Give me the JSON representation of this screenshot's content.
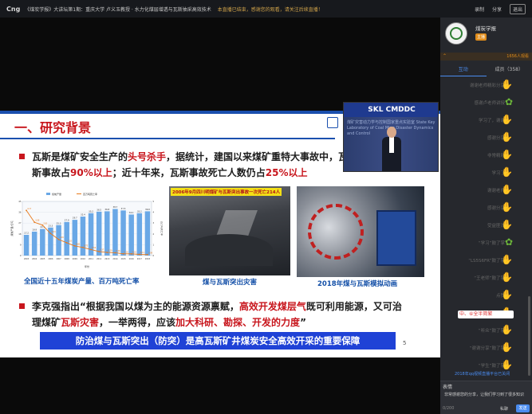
{
  "topbar": {
    "logo": "Cng",
    "title": "《煤炭学报》大讲坛第1期：重庆大学 卢义玉教授  · 水力化煤层增透与瓦斯抽采高效技术",
    "notice": "本直播已结束，感谢您的观看，请关注后续直播！",
    "btn_record": "录制",
    "btn_share": "分享",
    "btn_exit": "退出"
  },
  "slide": {
    "heading": "一、研究背景",
    "b1_a": "瓦斯是煤矿安全生产的",
    "b1_red1": "头号杀手",
    "b1_b": "，据统计，建国以来煤矿重特大事故中，瓦斯事故占",
    "b1_red2": "90%以上",
    "b1_c": "；近十年来，瓦斯事故死亡人数仍占",
    "b1_red3": "25%以上",
    "cap_chart": "全国近十五年煤炭产量、百万吨死亡率",
    "tunnel_tag": "2006年9月四川明煤矿与瓦斯突出事故一次死亡214人",
    "cap_tunnel": "煤与瓦斯突出灾害",
    "cap_sim": "2018年煤与瓦斯模拟动画",
    "b3_a": "李克强指出“根据我国以煤为主的能源资源禀赋，",
    "b3_red1": "高效开发煤层气",
    "b3_b": "既可利用能源，又可治理煤矿",
    "b3_red2": "瓦斯灾害",
    "b3_c": "，一举两得，应该",
    "b3_red3": "加大科研、勘探、开发的力度",
    "b3_d": "”",
    "banner": "防治煤与瓦斯突出（防突）是高瓦斯矿井煤炭安全高效开采的重要保障",
    "page": "5"
  },
  "camera": {
    "sign": "SKL CMDDC",
    "wall_text": "煤矿灾害动力学与控制国家重点实验室 State Key Laboratory of Coal Mine Disaster Dynamics and Control"
  },
  "chart_data": {
    "type": "bar",
    "title": "",
    "categories": [
      "2003",
      "2004",
      "2005",
      "2006",
      "2007",
      "2008",
      "2009",
      "2010",
      "2011",
      "2012",
      "2013",
      "2014",
      "2015",
      "2016",
      "2017",
      "2018"
    ],
    "series": [
      {
        "name": "煤炭产量",
        "values": [
          17.2,
          19.9,
          22.1,
          23.3,
          25.3,
          27.9,
          29.7,
          32.4,
          35.2,
          36.5,
          36.8,
          38.7,
          37.5,
          34.1,
          35.2,
          36.8
        ]
      },
      {
        "name": "百万吨死亡率",
        "values": [
          4.17,
          3.08,
          2.81,
          2.04,
          1.49,
          1.18,
          0.89,
          0.75,
          0.56,
          0.37,
          0.29,
          0.26,
          0.16,
          0.16,
          0.11,
          0.09
        ]
      }
    ],
    "legend": "top",
    "colors": [
      "#6aa8e6",
      "#e8791a"
    ],
    "xlabel": "年份",
    "ylabel": "煤炭产量/亿吨",
    "y2label": "百万吨死亡率",
    "ylim": [
      0,
      45
    ],
    "y2lim": [
      0,
      5
    ]
  },
  "sidebar": {
    "channel_name": "煤炭学报",
    "badge": "主播",
    "viewers": "1656人观看",
    "tabs": [
      "互动",
      "成员（358）"
    ],
    "messages": [
      {
        "text": "谢谢老师精彩分享",
        "icon": "hand"
      },
      {
        "text": "感谢卢老师讲授",
        "icon": "flower"
      },
      {
        "text": "学习了，谢谢",
        "icon": "hand"
      },
      {
        "text": "感谢分享",
        "icon": "hand"
      },
      {
        "text": "非常精彩",
        "icon": "hand"
      },
      {
        "text": "学习了",
        "icon": "hand"
      },
      {
        "text": "谢谢老师",
        "icon": "hand"
      },
      {
        "text": "感谢分享",
        "icon": "hand"
      },
      {
        "text": "受益匪浅",
        "icon": "hand"
      },
      {
        "text": "“学习”鼓了掌",
        "icon": "flower"
      },
      {
        "text": "“LS5S6FR”鼓了掌",
        "icon": "hand"
      },
      {
        "text": "“王老师”鼓了掌",
        "icon": "hand"
      },
      {
        "text": "点赞",
        "icon": "hand"
      },
      {
        "text": "感谢分享",
        "icon": "hand"
      },
      {
        "text": "“听众”鼓了掌",
        "icon": "hand"
      },
      {
        "text": "“谢谢分享”鼓了掌",
        "icon": "hand"
      },
      {
        "text": "“学生”鼓了掌",
        "icon": "hand"
      }
    ],
    "ime_text": "中、⑥全半简繁",
    "qr_text": "2018年qq视频直播平台已关闭",
    "input_emoji": "表情",
    "input_text": "非常感谢您的分享，让我们学习到了很多知识",
    "char_count": "0/200",
    "private": "私聊",
    "send": "发送"
  }
}
